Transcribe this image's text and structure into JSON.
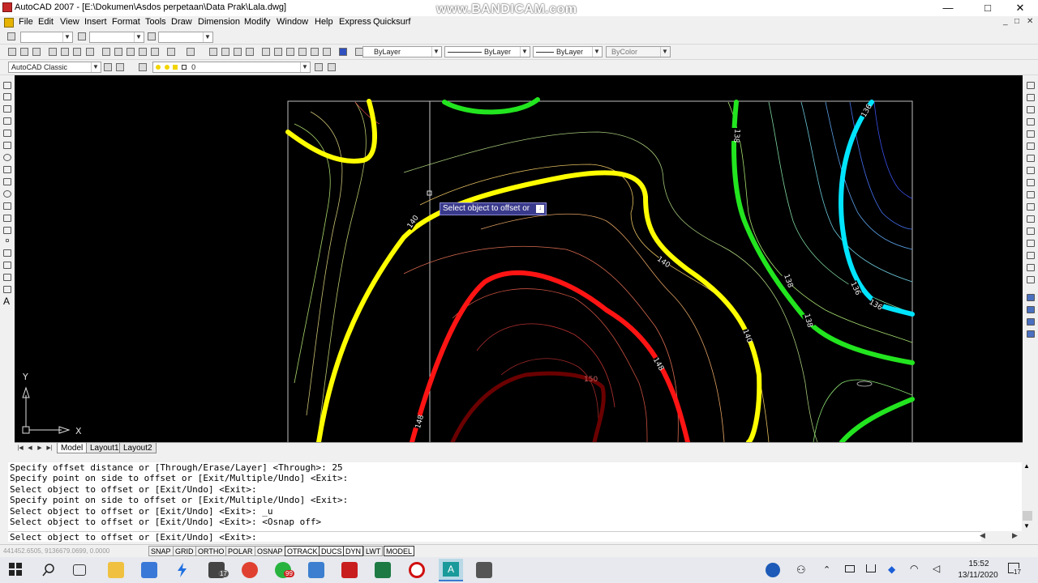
{
  "window": {
    "title": "AutoCAD 2007 - [E:\\Dokumen\\Asdos perpetaan\\Data Prak\\Lala.dwg]",
    "watermark": "www.BANDICAM.com",
    "min_label": "—",
    "max_label": "□",
    "close_label": "✕"
  },
  "menu": [
    "File",
    "Edit",
    "View",
    "Insert",
    "Format",
    "Tools",
    "Draw",
    "Dimension",
    "Modify",
    "Window",
    "Help",
    "Express",
    "Quicksurf"
  ],
  "mdi_controls": [
    "_",
    "□",
    "✕"
  ],
  "properties": {
    "color": "ByLayer",
    "linetype": "ByLayer",
    "lineweight": "ByLayer",
    "plotstyle": "ByColor"
  },
  "workspace": "AutoCAD Classic",
  "layer": "0",
  "drawing": {
    "tooltip": "Select object to offset or",
    "tooltip_icon": "↓",
    "ucs_x": "X",
    "ucs_y": "Y",
    "contour_labels": [
      "140",
      "140",
      "140",
      "140",
      "138",
      "138",
      "138",
      "138",
      "136",
      "136",
      "136",
      "148",
      "148",
      "150"
    ],
    "colors": {
      "background": "#000000",
      "yellow": "#ffff00",
      "green": "#22e51f",
      "cyan": "#00e5ff",
      "red": "#ff1414",
      "darkred": "#6a0000"
    }
  },
  "tabs": {
    "nav": [
      "|◀",
      "◀",
      "▶",
      "▶|"
    ],
    "items": [
      "Model",
      "Layout1",
      "Layout2"
    ]
  },
  "command": {
    "history": [
      "Specify offset distance or [Through/Erase/Layer] <Through>: 25",
      "Specify point on side to offset or [Exit/Multiple/Undo] <Exit>:",
      "Select object to offset or [Exit/Undo] <Exit>:",
      "Specify point on side to offset or [Exit/Multiple/Undo] <Exit>:",
      "Select object to offset or [Exit/Undo] <Exit>: _u",
      "Select object to offset or [Exit/Undo] <Exit>:  <Osnap off>"
    ],
    "prompt": "Select object to offset or [Exit/Undo] <Exit>:"
  },
  "status": {
    "coords": "441452.6505, 9136679.0699, 0.0000",
    "buttons": [
      "SNAP",
      "GRID",
      "ORTHO",
      "POLAR",
      "OSNAP",
      "OTRACK",
      "DUCS",
      "DYN",
      "LWT",
      "MODEL"
    ]
  },
  "taskbar": {
    "time": "15:52",
    "date": "13/11/2020",
    "mail_badge": "17",
    "whatsapp_badge": "99",
    "notif_badge": "17"
  }
}
